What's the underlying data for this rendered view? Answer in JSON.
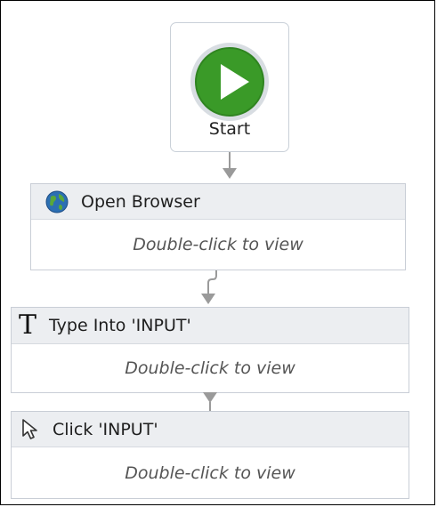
{
  "start": {
    "label": "Start"
  },
  "activities": [
    {
      "title": "Open Browser",
      "hint": "Double-click to view",
      "icon": "globe-icon"
    },
    {
      "title": "Type Into 'INPUT'",
      "hint": "Double-click to view",
      "icon": "text-T-icon"
    },
    {
      "title": "Click 'INPUT'",
      "hint": "Double-click to view",
      "icon": "cursor-arrow-icon"
    }
  ],
  "colors": {
    "start_green": "#3a9a28",
    "header_bg": "#eceef1",
    "border": "#c9ced6",
    "connector": "#9a9a9a"
  }
}
